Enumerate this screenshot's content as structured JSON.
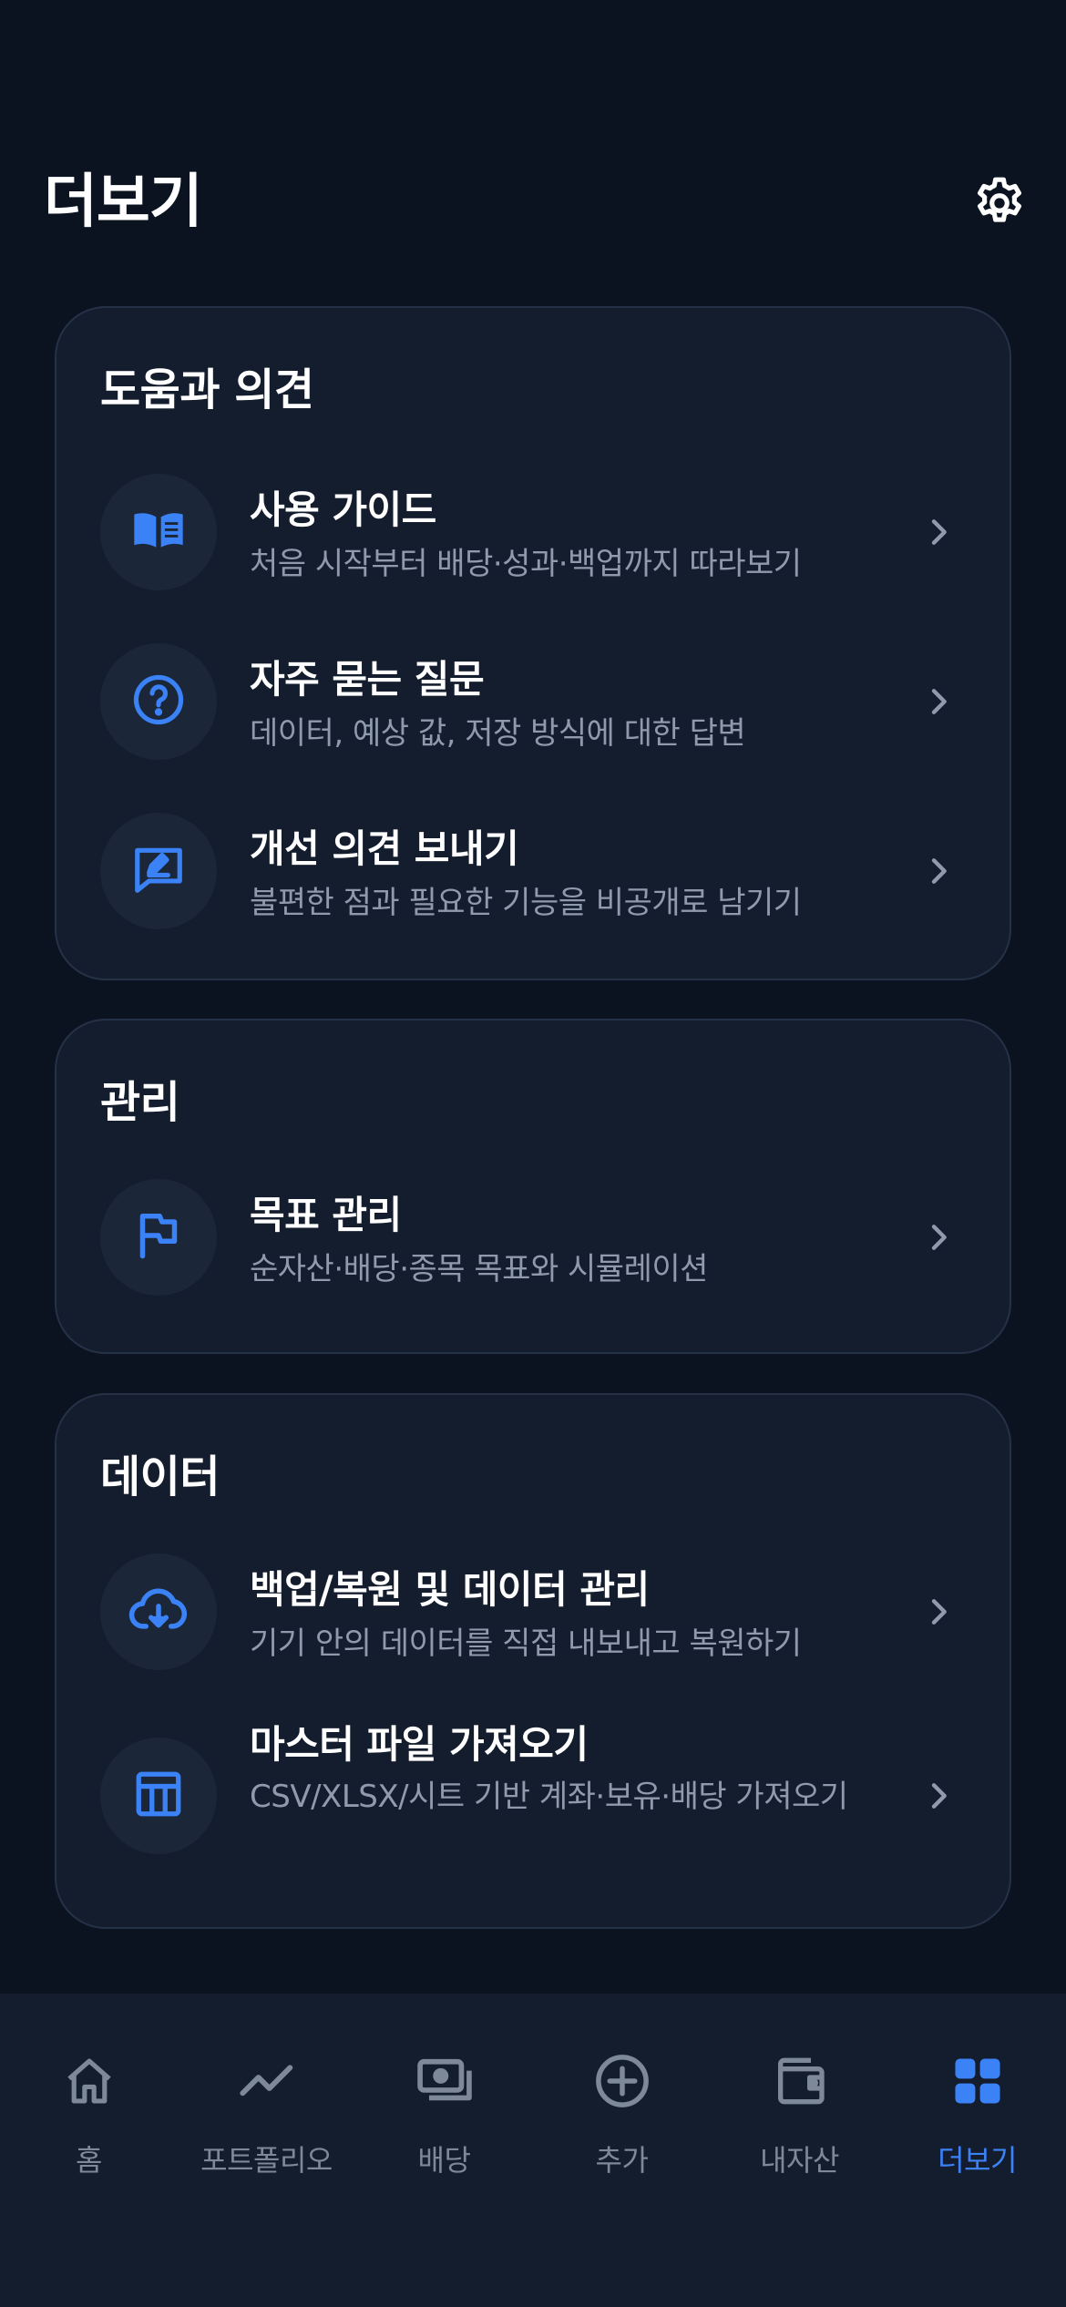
{
  "header": {
    "title": "더보기"
  },
  "sections": [
    {
      "title": "도움과 의견",
      "items": [
        {
          "title": "사용 가이드",
          "subtitle": "처음 시작부터 배당·성과·백업까지 따라보기",
          "icon": "book-icon"
        },
        {
          "title": "자주 묻는 질문",
          "subtitle": "데이터, 예상 값, 저장 방식에 대한 답변",
          "icon": "question-circle-icon"
        },
        {
          "title": "개선 의견 보내기",
          "subtitle": "불편한 점과 필요한 기능을 비공개로 남기기",
          "icon": "feedback-edit-icon"
        }
      ]
    },
    {
      "title": "관리",
      "items": [
        {
          "title": "목표 관리",
          "subtitle": "순자산·배당·종목 목표와 시뮬레이션",
          "icon": "flag-icon"
        }
      ]
    },
    {
      "title": "데이터",
      "items": [
        {
          "title": "백업/복원 및 데이터 관리",
          "subtitle": "기기 안의 데이터를 직접 내보내고 복원하기",
          "icon": "cloud-download-icon"
        },
        {
          "title": "마스터 파일 가져오기",
          "subtitle": "CSV/XLSX/시트 기반 계좌·보유·배당 가져오기",
          "icon": "table-icon"
        }
      ]
    }
  ],
  "tabbar": {
    "tabs": [
      {
        "label": "홈",
        "icon": "home-icon",
        "active": false
      },
      {
        "label": "포트폴리오",
        "icon": "trend-line-icon",
        "active": false
      },
      {
        "label": "배당",
        "icon": "cash-icon",
        "active": false
      },
      {
        "label": "추가",
        "icon": "plus-circle-icon",
        "active": false
      },
      {
        "label": "내자산",
        "icon": "wallet-icon",
        "active": false
      },
      {
        "label": "더보기",
        "icon": "grid-icon",
        "active": true
      }
    ]
  },
  "colors": {
    "background": "#0b1320",
    "card": "#141d2d",
    "card_border": "#253146",
    "icon_bg": "#1b2639",
    "accent": "#3b82f6",
    "muted_text": "#8f9bad",
    "tab_inactive": "#7d8898"
  }
}
